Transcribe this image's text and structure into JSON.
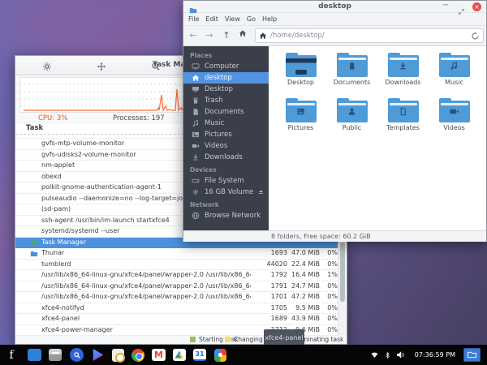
{
  "wallpaper": {
    "top_color": "#5a6ab8",
    "accent_color": "#7c5f9e",
    "bottom_color": "#463e60"
  },
  "colors": {
    "accent_blue": "#4d92dd",
    "cpu_orange": "#e8590c",
    "graph_line": "#ff6b35",
    "folder_blue": "#4f9bd8",
    "sidebar_bg": "#3b3f4a",
    "taskbar_bg": "#060607"
  },
  "task_manager": {
    "title": "Task Manager",
    "toolbar_icons": [
      "settings-gear-icon",
      "move-icon",
      "search-icon"
    ],
    "stats": {
      "cpu": "CPU: 3%",
      "processes": "Processes: 197"
    },
    "table_header": "Task",
    "rows": [
      {
        "name": "gvfs-mtp-volume-monitor",
        "pid": "",
        "mem": "",
        "cpu": ""
      },
      {
        "name": "gvfs-udisks2-volume-monitor",
        "pid": "",
        "mem": "",
        "cpu": ""
      },
      {
        "name": "nm-applet",
        "pid": "",
        "mem": "",
        "cpu": ""
      },
      {
        "name": "obexd",
        "pid": "",
        "mem": "",
        "cpu": ""
      },
      {
        "name": "polkit-gnome-authentication-agent-1",
        "pid": "",
        "mem": "",
        "cpu": ""
      },
      {
        "name": "pulseaudio --daemonize=no --log-target=journal",
        "pid": "",
        "mem": "",
        "cpu": ""
      },
      {
        "name": "(sd-pam)",
        "pid": "",
        "mem": "",
        "cpu": ""
      },
      {
        "name": "ssh-agent /usr/bin/im-launch startxfce4",
        "pid": "",
        "mem": "",
        "cpu": ""
      },
      {
        "name": "systemd/systemd --user",
        "pid": "",
        "mem": "",
        "cpu": ""
      },
      {
        "name": "Task Manager",
        "pid": "",
        "mem": "",
        "cpu": "",
        "selected": true,
        "icon": "task-manager-pulse-icon"
      },
      {
        "name": "Thunar",
        "pid": "1693",
        "mem": "47.0 MiB",
        "cpu": "0%",
        "icon": "thunar-folder-icon"
      },
      {
        "name": "tumblerd",
        "pid": "44020",
        "mem": "22.4 MiB",
        "cpu": "0%"
      },
      {
        "name": "/usr/lib/x86_64-linux-gnu/xfce4/panel/wrapper-2.0 /usr/lib/x86_64-linux-gnu/xfce4/panel/pl...",
        "pid": "1792",
        "mem": "16.4 MiB",
        "cpu": "1%"
      },
      {
        "name": "/usr/lib/x86_64-linux-gnu/xfce4/panel/wrapper-2.0 /usr/lib/x86_64-linux-gnu/xfce4/panel/pl...",
        "pid": "1791",
        "mem": "24.7 MiB",
        "cpu": "0%"
      },
      {
        "name": "/usr/lib/x86_64-linux-gnu/xfce4/panel/wrapper-2.0 /usr/lib/x86_64-linux-gnu/xfce4/panel/pl...",
        "pid": "1701",
        "mem": "47.2 MiB",
        "cpu": "0%"
      },
      {
        "name": "xfce4-notifyd",
        "pid": "1705",
        "mem": "9.5 MiB",
        "cpu": "0%"
      },
      {
        "name": "xfce4-panel",
        "pid": "1689",
        "mem": "43.9 MiB",
        "cpu": "0%"
      },
      {
        "name": "xfce4-power-manager",
        "pid": "1712",
        "mem": "9.6 MiB",
        "cpu": "0%"
      }
    ],
    "legend": [
      {
        "label": "Starting task",
        "color": "#98c05c"
      },
      {
        "label": "Changing task",
        "color": "#f3dc6b"
      },
      {
        "label": "Terminating task",
        "color": "#e05a4e"
      }
    ]
  },
  "file_manager": {
    "title": "desktop",
    "window_controls": [
      "minimize",
      "restore",
      "close"
    ],
    "menubar": [
      {
        "label": "File"
      },
      {
        "label": "Edit"
      },
      {
        "label": "View"
      },
      {
        "label": "Go"
      },
      {
        "label": "Help"
      }
    ],
    "toolbar": {
      "nav_icons": [
        "back-icon",
        "forward-icon",
        "up-icon",
        "home-icon"
      ],
      "path": "/home/desktop/",
      "refresh_icon": "refresh-icon"
    },
    "sidebar": {
      "sections": [
        {
          "header": "Places",
          "items": [
            {
              "label": "Computer",
              "icon": "computer"
            },
            {
              "label": "desktop",
              "icon": "home",
              "selected": true
            },
            {
              "label": "Desktop",
              "icon": "desktopmon"
            },
            {
              "label": "Trash",
              "icon": "trash"
            },
            {
              "label": "Documents",
              "icon": "doc"
            },
            {
              "label": "Music",
              "icon": "music"
            },
            {
              "label": "Pictures",
              "icon": "image"
            },
            {
              "label": "Videos",
              "icon": "video"
            },
            {
              "label": "Downloads",
              "icon": "download"
            }
          ]
        },
        {
          "header": "Devices",
          "items": [
            {
              "label": "File System",
              "icon": "drive"
            },
            {
              "label": "16 GB Volume",
              "icon": "usb",
              "eject": true
            }
          ]
        },
        {
          "header": "Network",
          "items": [
            {
              "label": "Browse Network",
              "icon": "globe"
            }
          ]
        }
      ]
    },
    "folders": [
      {
        "label": "Desktop",
        "glyph": "g-desktop"
      },
      {
        "label": "Documents",
        "glyph": "g-doc"
      },
      {
        "label": "Downloads",
        "glyph": "g-download"
      },
      {
        "label": "Music",
        "glyph": "g-music"
      },
      {
        "label": "Pictures",
        "glyph": "g-image"
      },
      {
        "label": "Public",
        "glyph": "g-person"
      },
      {
        "label": "Templates",
        "glyph": "g-file"
      },
      {
        "label": "Videos",
        "glyph": "g-video"
      }
    ],
    "statusbar": "8 folders, Free space: 60.2 GiB"
  },
  "tooltip": {
    "text": "xfce4-panel"
  },
  "taskbar": {
    "launchers": [
      {
        "icon": "f-launcher-icon",
        "glyph": "f"
      },
      {
        "icon": "file-manager-icon"
      },
      {
        "icon": "archive-icon"
      },
      {
        "icon": "search-icon"
      },
      {
        "icon": "play-store-icon"
      },
      {
        "icon": "media-player-icon"
      },
      {
        "icon": "chrome-icon"
      },
      {
        "icon": "gmail-icon",
        "glyph": "M"
      },
      {
        "icon": "google-drive-icon"
      },
      {
        "icon": "calendar-icon",
        "glyph": "31"
      },
      {
        "icon": "google-d-icon"
      }
    ],
    "tray_icons": [
      "wifi-icon",
      "bluetooth-icon",
      "volume-icon"
    ],
    "clock": "07:36:59 PM",
    "window_button": "desktop-folder-window"
  }
}
